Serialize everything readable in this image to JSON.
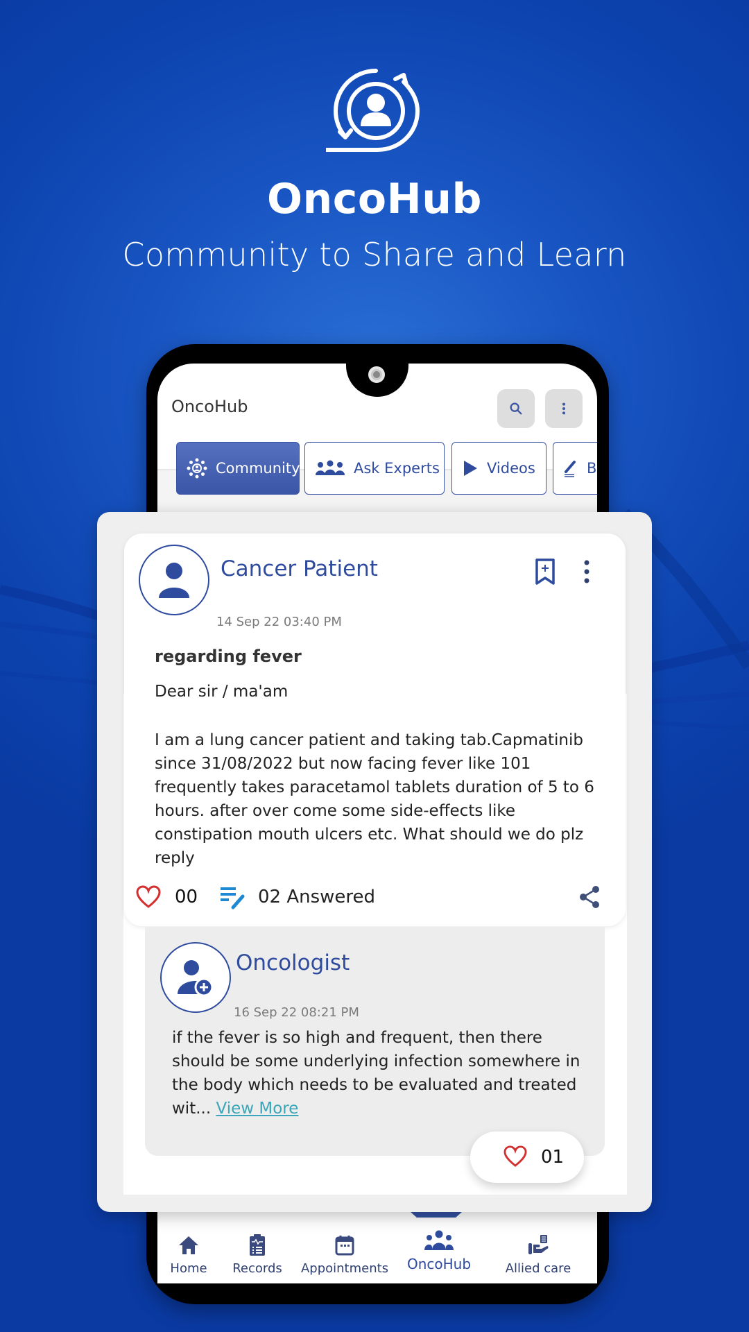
{
  "hero": {
    "logo_icon": "community-cycle-icon",
    "title": "OncoHub",
    "subtitle": "Community to Share and Learn"
  },
  "app": {
    "title": "OncoHub",
    "search_icon": "search-icon",
    "menu_icon": "more-vert-icon"
  },
  "tabs": [
    {
      "label": "Community",
      "icon": "community-icon",
      "active": true
    },
    {
      "label": "Ask Experts",
      "icon": "experts-icon",
      "active": false
    },
    {
      "label": "Videos",
      "icon": "play-icon",
      "active": false
    },
    {
      "label": "Blogs",
      "visible_label": "B",
      "icon": "edit-icon",
      "active": false
    }
  ],
  "post": {
    "author": "Cancer Patient",
    "timestamp": "14 Sep 22 03:40 PM",
    "title": "regarding fever",
    "greeting": "Dear sir / ma'am",
    "body": "I am a  lung cancer patient and taking tab.Capmatinib since 31/08/2022 but now facing fever like 101 frequently takes paracetamol tablets duration of 5 to 6 hours. after over come some side-effects like constipation mouth ulcers etc. What should we do plz reply",
    "likes": "00",
    "answers": "02 Answered"
  },
  "answer": {
    "author": "Oncologist",
    "timestamp": "16 Sep 22 08:21 PM",
    "body": "if the fever is so high and frequent, then there should be some underlying infection somewhere in the body which needs to be evaluated and treated wit... ",
    "view_more": "View More",
    "likes": "01"
  },
  "bottom_nav": [
    {
      "label": "Home",
      "icon": "home-icon",
      "active": false
    },
    {
      "label": "Records",
      "icon": "clipboard-icon",
      "active": false
    },
    {
      "label": "Appointments",
      "icon": "calendar-icon",
      "active": false
    },
    {
      "label": "OncoHub",
      "icon": "group-icon",
      "active": true
    },
    {
      "label": "Allied care",
      "icon": "care-hand-icon",
      "active": false
    }
  ],
  "colors": {
    "brand_blue": "#2f4b9e",
    "background_blue": "#1a57c4",
    "like_red": "#d32f2f",
    "link_teal": "#3aa6b9"
  }
}
